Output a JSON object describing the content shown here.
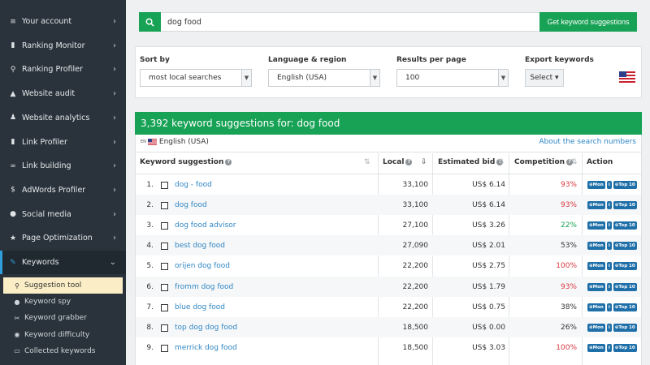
{
  "sidebar": {
    "items": [
      {
        "label": "Your account",
        "icon": "list-icon",
        "glyph": "≡"
      },
      {
        "label": "Ranking Monitor",
        "icon": "bar-chart-icon",
        "glyph": "▮"
      },
      {
        "label": "Ranking Profiler",
        "icon": "search-icon",
        "glyph": "⚲"
      },
      {
        "label": "Website audit",
        "icon": "flask-icon",
        "glyph": "▲"
      },
      {
        "label": "Website analytics",
        "icon": "person-icon",
        "glyph": "♟"
      },
      {
        "label": "Link Profiler",
        "icon": "bar-chart-icon",
        "glyph": "▮"
      },
      {
        "label": "Link building",
        "icon": "link-icon",
        "glyph": "∞"
      },
      {
        "label": "AdWords Profiler",
        "icon": "dollar-icon",
        "glyph": "$"
      },
      {
        "label": "Social media",
        "icon": "chat-icon",
        "glyph": "●"
      },
      {
        "label": "Page Optimization",
        "icon": "star-icon",
        "glyph": "★"
      },
      {
        "label": "Keywords",
        "icon": "wrench-icon",
        "glyph": "✎"
      }
    ],
    "chevron_right": "›",
    "chevron_down": "⌄",
    "sub_items": [
      {
        "label": "Suggestion tool",
        "icon": "search-icon",
        "glyph": "⚲"
      },
      {
        "label": "Keyword spy",
        "icon": "user-icon",
        "glyph": "●"
      },
      {
        "label": "Keyword grabber",
        "icon": "scissors-icon",
        "glyph": "✂"
      },
      {
        "label": "Keyword difficulty",
        "icon": "gauge-icon",
        "glyph": "◉"
      },
      {
        "label": "Collected keywords",
        "icon": "inbox-icon",
        "glyph": "▭"
      }
    ]
  },
  "search": {
    "value": "dog food",
    "button_label": "Get keyword suggestions"
  },
  "filters": {
    "sort_label": "Sort by",
    "sort_value": "most local searches",
    "lang_label": "Language & region",
    "lang_value": "English (USA)",
    "results_label": "Results per page",
    "results_value": "100",
    "export_label": "Export keywords",
    "export_button": "Select ▾"
  },
  "results": {
    "header": "3,392 keyword suggestions for: dog food",
    "lang_badge": "EN",
    "lang_text": "English (USA)",
    "about_link": "About the search numbers",
    "columns": {
      "keyword": "Keyword suggestion",
      "local": "Local",
      "bid": "Estimated bid",
      "competition": "Competition",
      "action": "Action"
    },
    "action_labels": {
      "mon": "⊕Mon",
      "info": "i",
      "top": "⊕Top 10"
    },
    "rows": [
      {
        "num": "1.",
        "keyword": "dog - food",
        "local": "33,100",
        "bid": "US$ 6.14",
        "competition": "93%",
        "level": "red"
      },
      {
        "num": "2.",
        "keyword": "dog food",
        "local": "33,100",
        "bid": "US$ 6.14",
        "competition": "93%",
        "level": "red"
      },
      {
        "num": "3.",
        "keyword": "dog food advisor",
        "local": "27,100",
        "bid": "US$ 3.26",
        "competition": "22%",
        "level": "green"
      },
      {
        "num": "4.",
        "keyword": "best dog food",
        "local": "27,090",
        "bid": "US$ 2.01",
        "competition": "53%",
        "level": "dark"
      },
      {
        "num": "5.",
        "keyword": "orijen dog food",
        "local": "22,200",
        "bid": "US$ 2.75",
        "competition": "100%",
        "level": "red"
      },
      {
        "num": "6.",
        "keyword": "fromm dog food",
        "local": "22,200",
        "bid": "US$ 1.79",
        "competition": "93%",
        "level": "red"
      },
      {
        "num": "7.",
        "keyword": "blue dog food",
        "local": "22,200",
        "bid": "US$ 0.75",
        "competition": "38%",
        "level": "dark"
      },
      {
        "num": "8.",
        "keyword": "top dog dog food",
        "local": "18,500",
        "bid": "US$ 0.00",
        "competition": "26%",
        "level": "dark"
      },
      {
        "num": "9.",
        "keyword": "merrick dog food",
        "local": "18,500",
        "bid": "US$ 3.03",
        "competition": "100%",
        "level": "red"
      }
    ]
  },
  "colors": {
    "green": "#17a255",
    "sidebar": "#2a333b",
    "link": "#2f86c4",
    "red": "#d9363e",
    "action": "#1f6fa8",
    "selected": "#fbeec6"
  }
}
